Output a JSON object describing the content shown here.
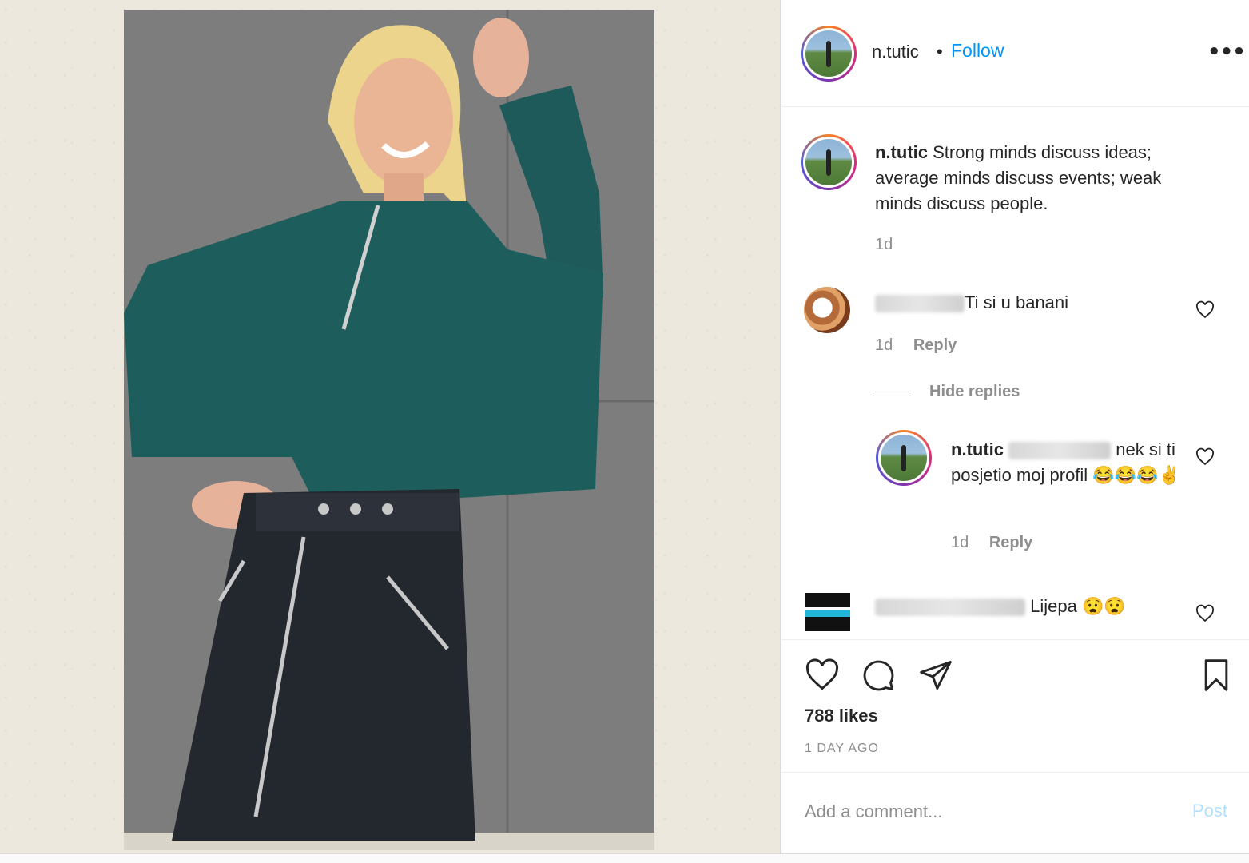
{
  "post": {
    "username": "n.tutic",
    "separator": "•",
    "follow_label": "Follow",
    "more_label": "•••"
  },
  "caption": {
    "username": "n.tutic",
    "text": "Strong minds discuss ideas; average minds discuss events; weak minds discuss people.",
    "time": "1d"
  },
  "comments": [
    {
      "text": "Ti si u banani",
      "time": "1d",
      "reply_label": "Reply"
    },
    {
      "text": "Lijepa 😧😧"
    }
  ],
  "hide_replies_label": "Hide replies",
  "reply": {
    "username": "n.tutic",
    "text": "nek si ti posjetio moj profil 😂😂😂✌",
    "time": "1d",
    "reply_label": "Reply"
  },
  "actions": {
    "likes": "788 likes",
    "time_ago": "1 DAY AGO"
  },
  "add_comment": {
    "placeholder": "Add a comment...",
    "post_label": "Post"
  },
  "icons": [
    "heart-icon",
    "comment-icon",
    "share-icon",
    "bookmark-icon",
    "small-heart-icon",
    "more-icon"
  ],
  "colors": {
    "link": "#0095f6",
    "post_disabled": "#b2dffc",
    "muted": "#8e8e8e",
    "text": "#262626"
  }
}
